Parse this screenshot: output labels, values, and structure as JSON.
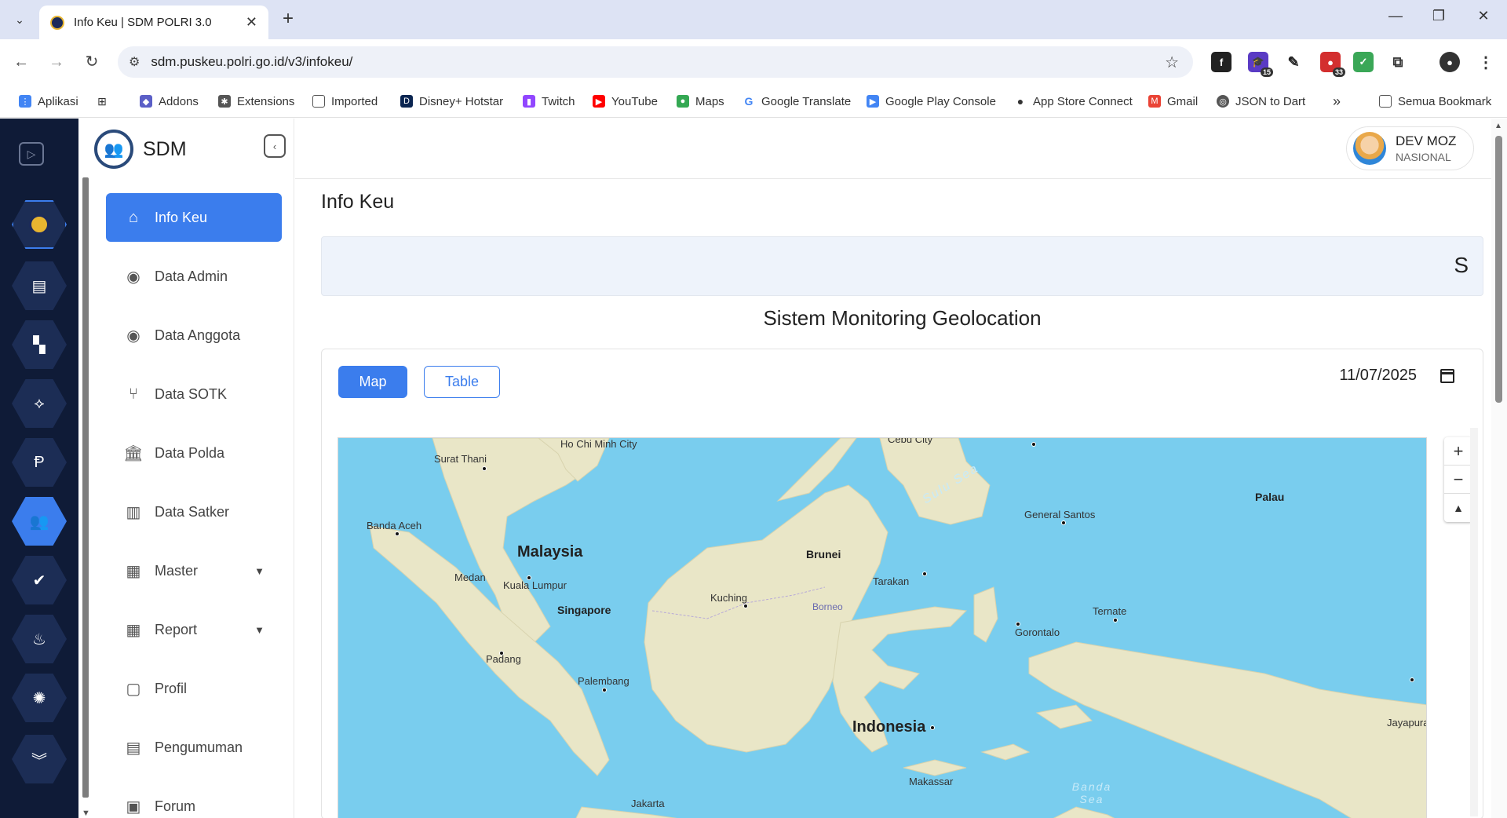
{
  "browser": {
    "tab_title": "Info Keu | SDM POLRI 3.0",
    "url": "sdm.puskeu.polri.go.id/v3/infokeu/",
    "bookmarks": [
      "Aplikasi",
      "Addons",
      "Extensions",
      "Imported",
      "Disney+ Hotstar",
      "Twitch",
      "YouTube",
      "Maps",
      "Google Translate",
      "Google Play Console",
      "App Store Connect",
      "Gmail",
      "JSON to Dart"
    ],
    "bookmarks_overflow": "»",
    "all_bookmarks": "Semua Bookmark",
    "ext_badges": {
      "e2": "15",
      "e5": "33"
    }
  },
  "app": {
    "brand": "SDM",
    "user": {
      "name": "DEV MOZ",
      "role": "NASIONAL"
    },
    "menu": [
      {
        "label": "Info Keu",
        "icon": "home-icon"
      },
      {
        "label": "Data Admin",
        "icon": "user-circle-icon"
      },
      {
        "label": "Data Anggota",
        "icon": "user-circle-icon"
      },
      {
        "label": "Data SOTK",
        "icon": "git-branch-icon"
      },
      {
        "label": "Data Polda",
        "icon": "bank-icon"
      },
      {
        "label": "Data Satker",
        "icon": "building-icon"
      },
      {
        "label": "Master",
        "icon": "grid-icon"
      },
      {
        "label": "Report",
        "icon": "grid-icon"
      },
      {
        "label": "Profil",
        "icon": "file-user-icon"
      },
      {
        "label": "Pengumuman",
        "icon": "clipboard-icon"
      },
      {
        "label": "Forum",
        "icon": "forum-icon"
      }
    ]
  },
  "main": {
    "page_title": "Info Keu",
    "marquee_text": "S",
    "section_title": "Sistem Monitoring Geolocation",
    "tabs": {
      "map": "Map",
      "table": "Table"
    },
    "date_value": "11/07/2025"
  },
  "map": {
    "labels": {
      "ho_chi_minh": "Ho Chi Minh City",
      "surat_thani": "Surat Thani",
      "banda_aceh": "Banda Aceh",
      "malaysia": "Malaysia",
      "medan": "Medan",
      "kuala_lumpur": "Kuala Lumpur",
      "singapore": "Singapore",
      "padang": "Padang",
      "palembang": "Palembang",
      "jakarta": "Jakarta",
      "brunei": "Brunei",
      "kuching": "Kuching",
      "borneo": "Borneo",
      "tarakan": "Tarakan",
      "sulu_sea": "Sulu Sea",
      "general_santos": "General Santos",
      "palau": "Palau",
      "cebu": "Cebu City",
      "gorontalo": "Gorontalo",
      "ternate": "Ternate",
      "indonesia": "Indonesia",
      "makassar": "Makassar",
      "banda_sea": "Banda Sea",
      "jayapura": "Jayapura"
    },
    "zoom_in": "+",
    "zoom_out": "−",
    "reset": "▲"
  }
}
